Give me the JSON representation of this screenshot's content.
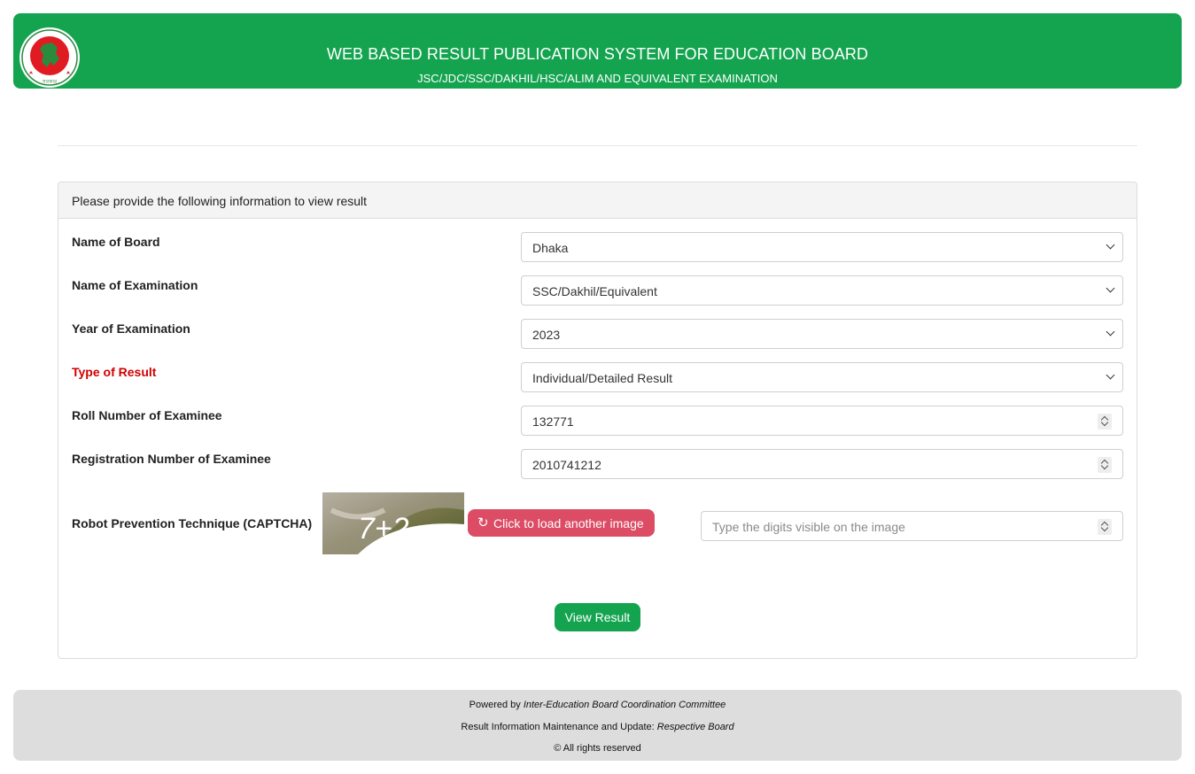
{
  "header": {
    "title": "WEB BASED RESULT PUBLICATION SYSTEM FOR EDUCATION BOARD",
    "subtitle": "JSC/JDC/SSC/DAKHIL/HSC/ALIM AND EQUIVALENT EXAMINATION",
    "logo_icon": "bangladesh-government-seal",
    "logo_text_top": "গণপ্রজাতন্ত্রী বাংলাদেশ",
    "logo_text_bottom": "সরকার"
  },
  "form": {
    "panel_heading": "Please provide the following information to view result",
    "board": {
      "label": "Name of Board",
      "value": "Dhaka"
    },
    "exam": {
      "label": "Name of Examination",
      "value": "SSC/Dakhil/Equivalent"
    },
    "year": {
      "label": "Year of Examination",
      "value": "2023"
    },
    "result_type": {
      "label": "Type of Result",
      "value": "Individual/Detailed Result",
      "label_color": "#d10000"
    },
    "roll": {
      "label": "Roll Number of Examinee",
      "value": "132771"
    },
    "registration": {
      "label": "Registration Number of Examinee",
      "value": "2010741212"
    },
    "captcha": {
      "label": "Robot Prevention Technique (CAPTCHA)",
      "image_text": "7+2",
      "reload_label": "Click to load another image",
      "reload_icon": "refresh-icon",
      "input_placeholder": "Type the digits visible on the image"
    },
    "submit_label": "View Result"
  },
  "footer": {
    "powered_prefix": "Powered by ",
    "powered_by": "Inter-Education Board Coordination Committee",
    "maintenance_prefix": "Result Information Maintenance and Update: ",
    "maintenance_by": "Respective Board",
    "copyright": "© All rights reserved"
  },
  "colors": {
    "brand_green": "#14a44f",
    "danger": "#dc4c64",
    "footer_bg": "#dddddd"
  }
}
